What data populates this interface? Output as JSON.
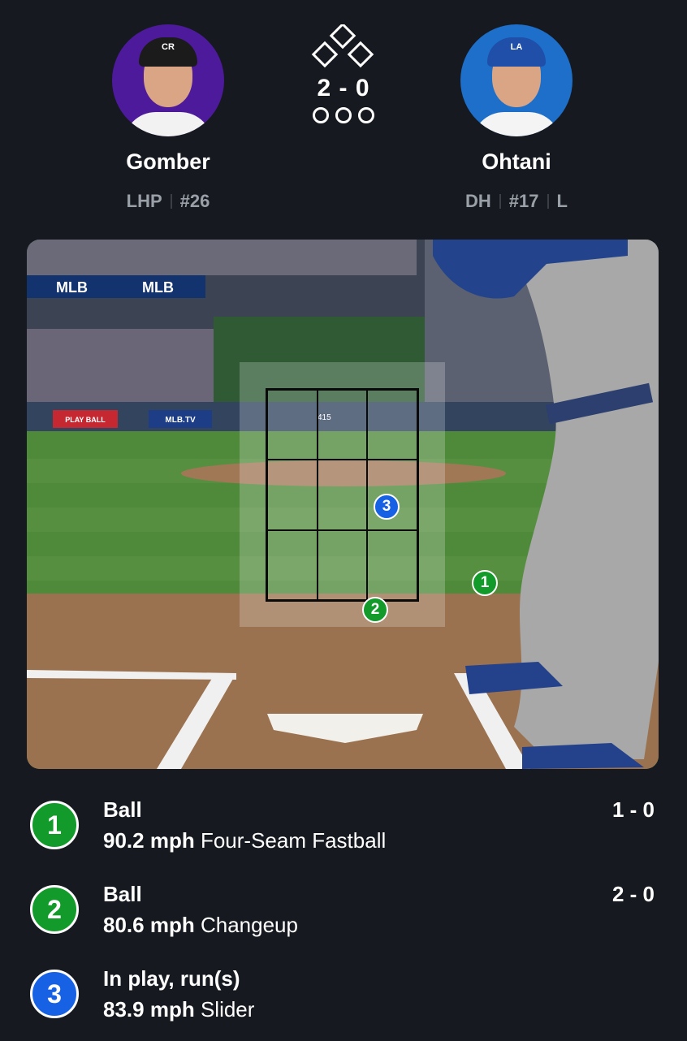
{
  "pitcher": {
    "name": "Gomber",
    "position": "LHP",
    "number": "#26",
    "team_color": "#4e1a9c",
    "cap_logo": "CR"
  },
  "batter": {
    "name": "Ohtani",
    "position": "DH",
    "number": "#17",
    "bats": "L",
    "team_color": "#1d6fc9",
    "cap_logo": "LA"
  },
  "game_state": {
    "count": "2 - 0",
    "bases_occupied": [
      false,
      false,
      false
    ],
    "outs": 0
  },
  "field_view": {
    "signage": {
      "mlb_1": "MLB",
      "mlb_2": "MLB",
      "play_ball": "PLAY BALL",
      "mlb_tv": "MLB.TV",
      "distance": "415"
    },
    "markers": [
      {
        "num": "1",
        "color": "green"
      },
      {
        "num": "2",
        "color": "green"
      },
      {
        "num": "3",
        "color": "blue"
      }
    ]
  },
  "pitches": [
    {
      "num": "1",
      "result": "Ball",
      "speed": "90.2 mph",
      "type": "Four-Seam Fastball",
      "count": "1 - 0",
      "color": "#129a2a"
    },
    {
      "num": "2",
      "result": "Ball",
      "speed": "80.6 mph",
      "type": "Changeup",
      "count": "2 - 0",
      "color": "#129a2a"
    },
    {
      "num": "3",
      "result": "In play, run(s)",
      "speed": "83.9 mph",
      "type": "Slider",
      "count": "",
      "color": "#1761e4"
    }
  ]
}
